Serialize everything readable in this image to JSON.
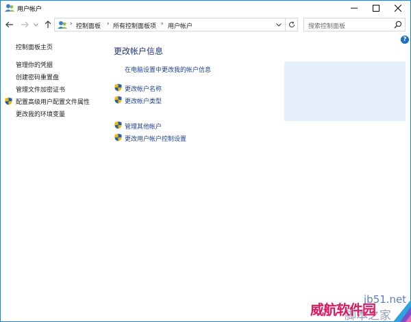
{
  "window": {
    "title": "用户帐户",
    "controls": {
      "minimize": "—",
      "maximize": "□",
      "close": "✕"
    }
  },
  "addressbar": {
    "breadcrumbs": [
      "控制面板",
      "所有控制面板项",
      "用户帐户"
    ],
    "separator": "›",
    "search_placeholder": "搜索控制面板"
  },
  "help": {
    "label": "?"
  },
  "left_pane": {
    "items": [
      {
        "label": "控制面板主页",
        "shield": false
      },
      {
        "label": "管理你的凭据",
        "shield": false
      },
      {
        "label": "创建密码重置盘",
        "shield": false
      },
      {
        "label": "管理文件加密证书",
        "shield": false
      },
      {
        "label": "配置高级用户配置文件属性",
        "shield": true
      },
      {
        "label": "更改我的环境变量",
        "shield": false
      }
    ]
  },
  "main": {
    "title": "更改帐户信息",
    "pc_settings_link": "在电脑设置中更改我的帐户信息",
    "links": [
      {
        "label": "更改帐户名称",
        "shield": true
      },
      {
        "label": "更改帐户类型",
        "shield": true
      },
      {
        "label": "管理其他帐户",
        "shield": true
      },
      {
        "label": "更改用户帐户控制设置",
        "shield": true
      }
    ]
  },
  "watermark": {
    "site": "jb51.net",
    "brand_red": "威航软件园",
    "brand_gray": "脚本之家"
  },
  "colors": {
    "title_blue": "#1e3287",
    "link_blue": "#1c3f94",
    "panel_bg": "#e6f0fb",
    "border_blue": "#1883d7"
  }
}
